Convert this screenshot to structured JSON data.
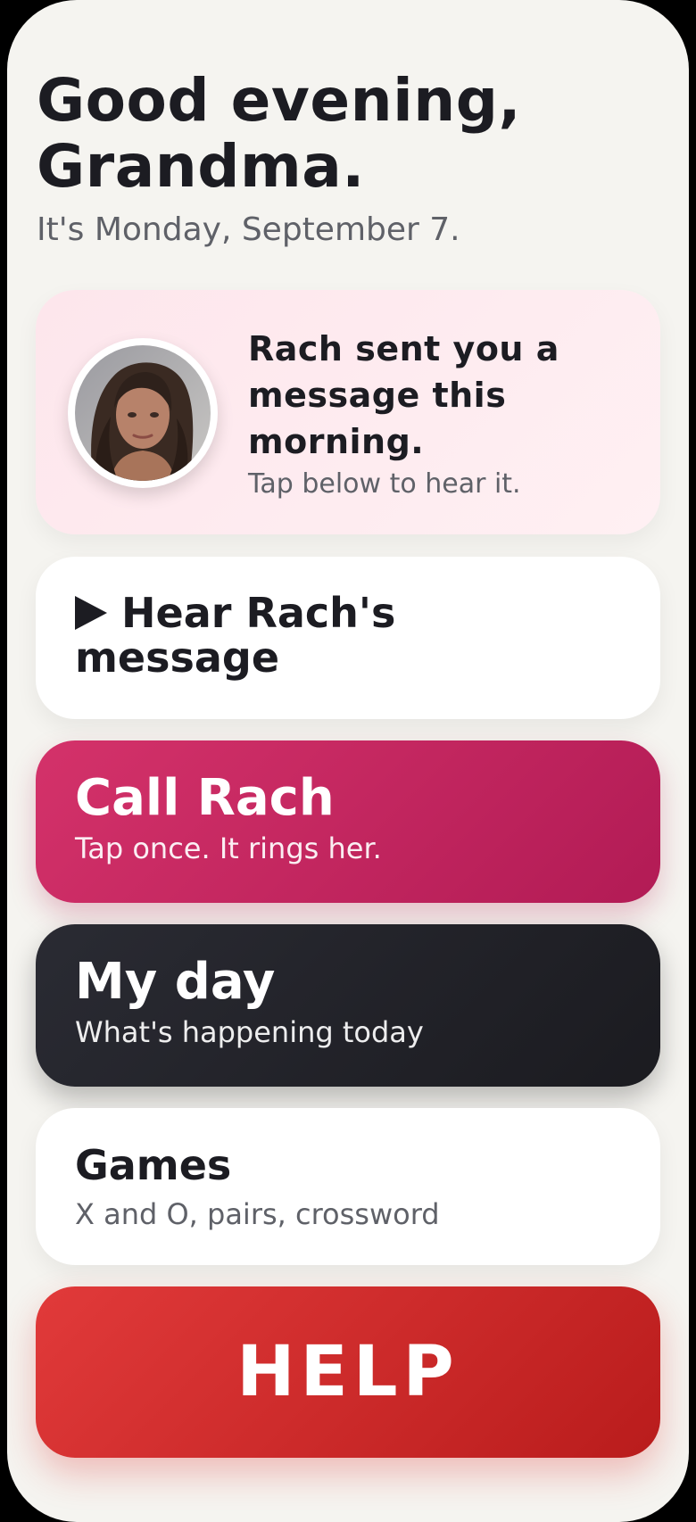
{
  "header": {
    "greeting": "Good evening, Grandma.",
    "date": "It's Monday, September 7."
  },
  "message_card": {
    "title": "Rach sent you a message this morning.",
    "subtitle": "Tap below to hear it.",
    "avatar": "contact-photo-rach"
  },
  "hear_button": {
    "icon": "play-icon",
    "label": "Hear Rach's message"
  },
  "call_button": {
    "title": "Call Rach",
    "subtitle": "Tap once. It rings her."
  },
  "my_day_button": {
    "title": "My day",
    "subtitle": "What's happening today"
  },
  "games_button": {
    "title": "Games",
    "subtitle": "X and O, pairs, crossword"
  },
  "help_button": {
    "label": "HELP"
  },
  "colors": {
    "background": "#f5f4f0",
    "message_card": "#fde6ec",
    "call": "#c82860",
    "my_day": "#232329",
    "help": "#d02a2a",
    "text_primary": "#1c1c22",
    "text_secondary": "#5f6168"
  }
}
